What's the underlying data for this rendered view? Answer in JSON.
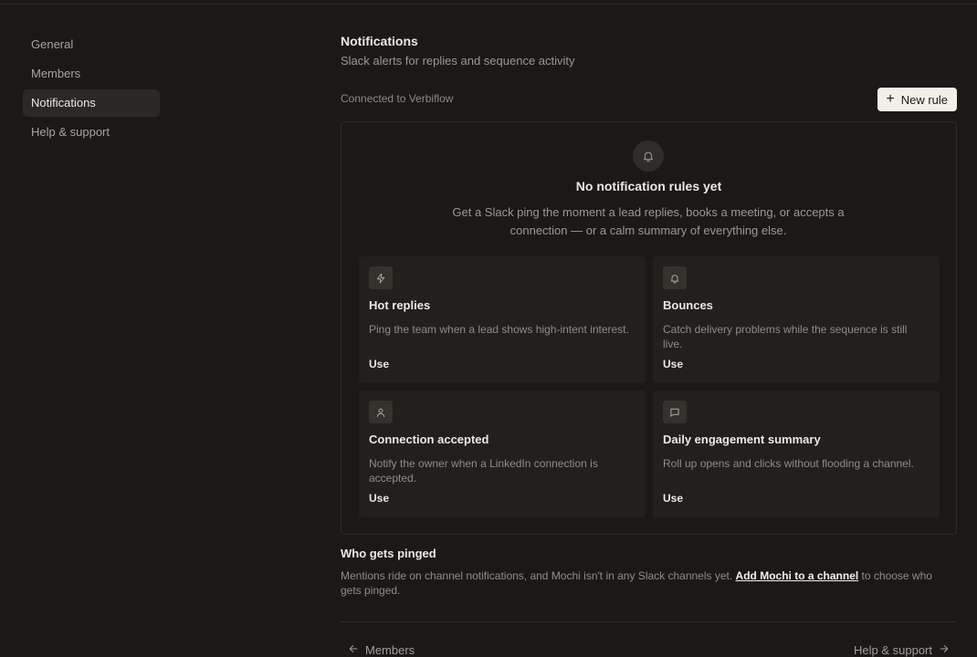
{
  "sidebar": {
    "items": [
      {
        "label": "General",
        "active": false
      },
      {
        "label": "Members",
        "active": false
      },
      {
        "label": "Notifications",
        "active": true
      },
      {
        "label": "Help & support",
        "active": false
      }
    ]
  },
  "header": {
    "title": "Notifications",
    "subtitle": "Slack alerts for replies and sequence activity",
    "connected": "Connected to Verbiflow",
    "new_rule_label": "New rule"
  },
  "empty_state": {
    "icon": "bell-icon",
    "title": "No notification rules yet",
    "description": "Get a Slack ping the moment a lead replies, books a meeting, or accepts a connection — or a calm summary of everything else."
  },
  "templates": [
    {
      "icon": "lightning-icon",
      "title": "Hot replies",
      "description": "Ping the team when a lead shows high-intent interest.",
      "action": "Use"
    },
    {
      "icon": "bell-icon",
      "title": "Bounces",
      "description": "Catch delivery problems while the sequence is still live.",
      "action": "Use"
    },
    {
      "icon": "person-icon",
      "title": "Connection accepted",
      "description": "Notify the owner when a LinkedIn connection is accepted.",
      "action": "Use"
    },
    {
      "icon": "message-icon",
      "title": "Daily engagement summary",
      "description": "Roll up opens and clicks without flooding a channel.",
      "action": "Use"
    }
  ],
  "who_gets_pinged": {
    "title": "Who gets pinged",
    "text_before": "Mentions ride on channel notifications, and Mochi isn't in any Slack channels yet. ",
    "link": "Add Mochi to a channel",
    "text_after": " to choose who gets pinged."
  },
  "footer": {
    "prev_label": "Members",
    "next_label": "Help & support"
  },
  "colors": {
    "background": "#1b1917",
    "card": "#221f1c",
    "primary_button": "#f3efe8"
  }
}
